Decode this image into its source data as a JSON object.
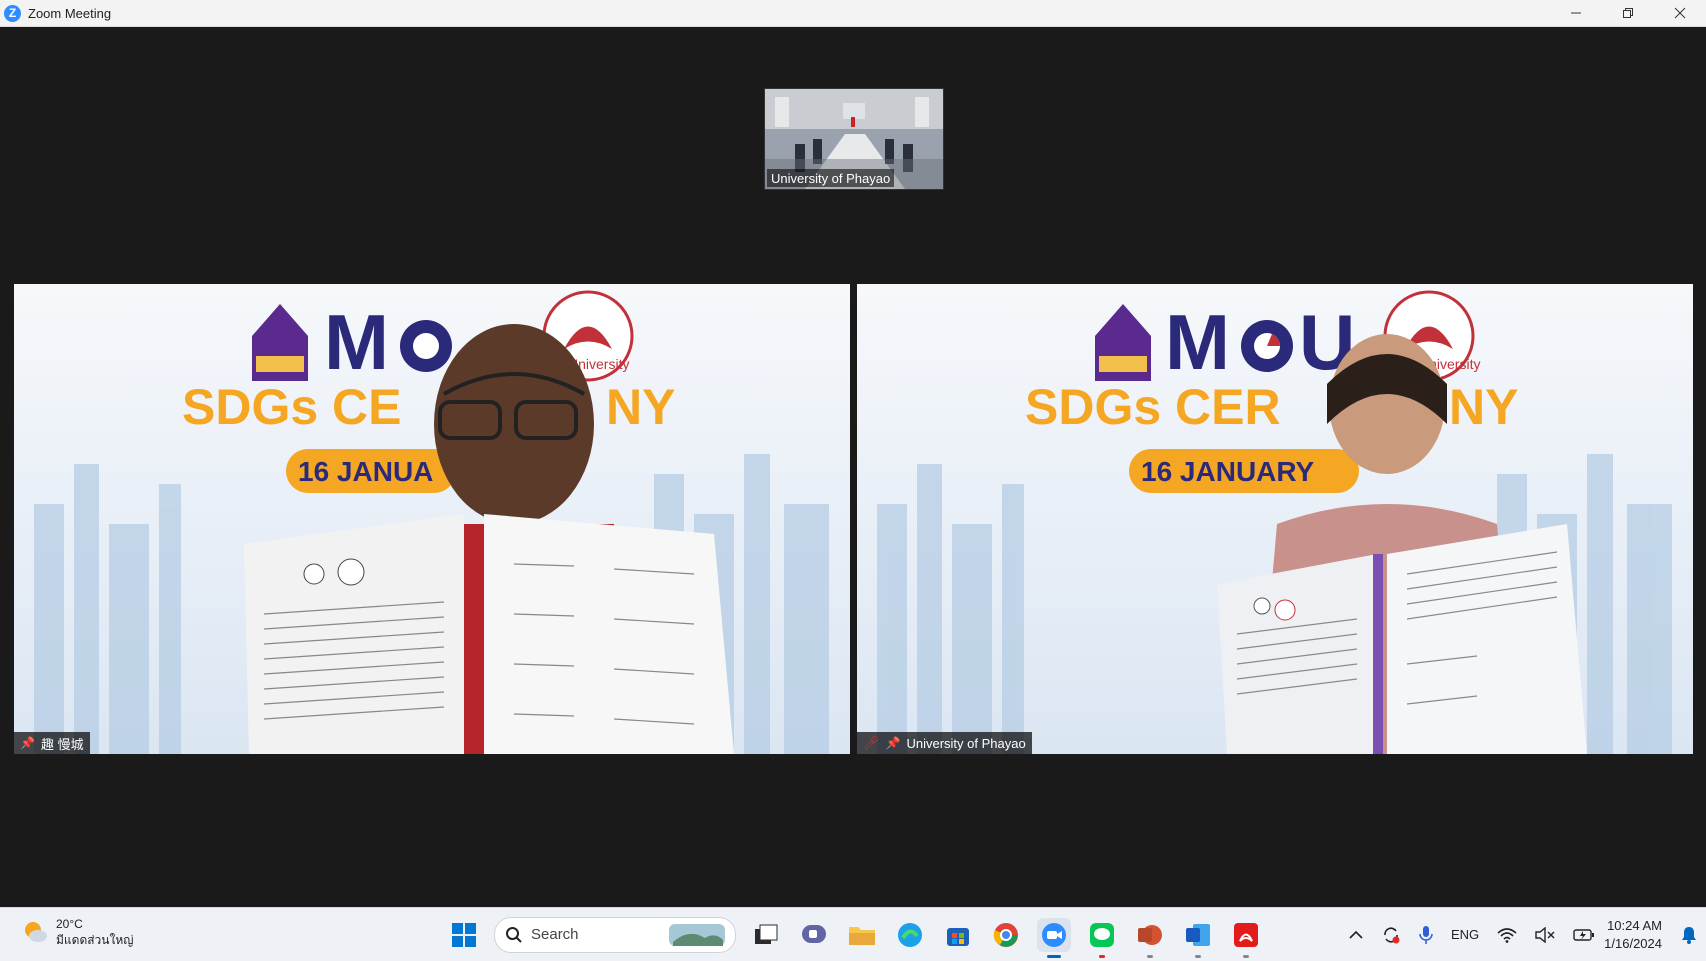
{
  "window": {
    "title": "Zoom Meeting",
    "icon_letter": "Z",
    "controls": [
      "minimize-icon",
      "restore-icon",
      "close-icon"
    ]
  },
  "meeting": {
    "thumbnail": {
      "name": "University of Phayao"
    },
    "tiles": [
      {
        "name": "趣 慢城",
        "pinned": true,
        "mic_muted": false,
        "banner": {
          "line1": "MOU",
          "line2": "SDGs CEREMONY",
          "date": "16 JANUARY",
          "partner": "University"
        }
      },
      {
        "name": "University of Phayao",
        "pinned": true,
        "mic_muted": true,
        "banner": {
          "line1": "MOU",
          "line2": "SDGs CEREMONY",
          "date": "16 JANUARY",
          "partner": "University"
        }
      }
    ]
  },
  "taskbar": {
    "weather": {
      "temp": "20°C",
      "desc": "มีแดดส่วนใหญ่"
    },
    "search_placeholder": "Search",
    "apps": [
      "start-icon",
      "task-view-icon",
      "teams-chat-icon",
      "file-explorer-icon",
      "edge-icon",
      "store-icon",
      "chrome-icon",
      "zoom-icon",
      "line-icon",
      "powerpoint-icon",
      "word-icon",
      "acrobat-icon"
    ],
    "tray": {
      "lang": "ENG",
      "time": "10:24 AM",
      "date": "1/16/2024"
    }
  },
  "colors": {
    "banner_navy": "#2b2a7a",
    "banner_orange": "#f5a623",
    "zoom_blue": "#2d8cff",
    "mute_red": "#e02828"
  }
}
